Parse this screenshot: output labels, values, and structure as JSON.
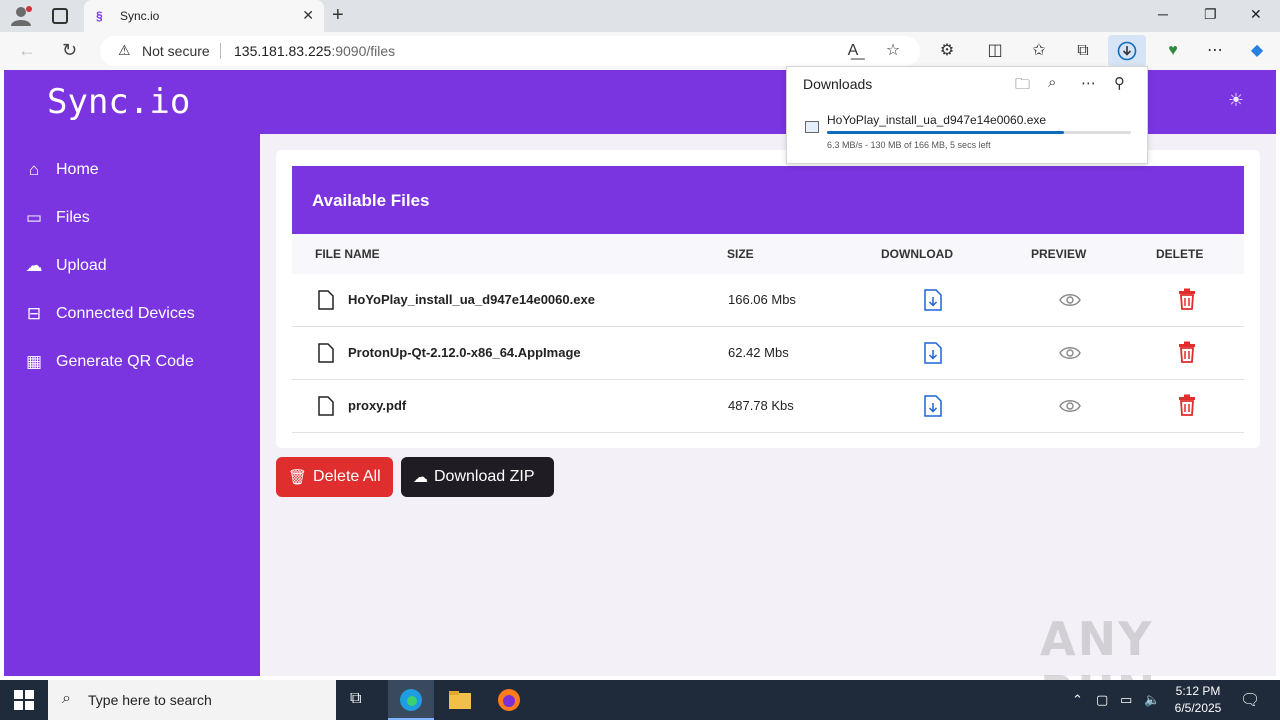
{
  "browser": {
    "tab_title": "Sync.io",
    "security_label": "Not secure",
    "url_host": "135.181.83.225",
    "url_rest": ":9090/files"
  },
  "app": {
    "brand": "Sync.io",
    "sidebar": {
      "items": [
        {
          "label": "Home",
          "icon": "home-icon"
        },
        {
          "label": "Files",
          "icon": "folder-icon"
        },
        {
          "label": "Upload",
          "icon": "cloud-upload-icon"
        },
        {
          "label": "Connected Devices",
          "icon": "router-icon"
        },
        {
          "label": "Generate QR Code",
          "icon": "qr-code-icon"
        }
      ]
    },
    "files_card": {
      "title": "Available Files",
      "columns": [
        "FILE NAME",
        "SIZE",
        "DOWNLOAD",
        "PREVIEW",
        "DELETE"
      ],
      "rows": [
        {
          "name": "HoYoPlay_install_ua_d947e14e0060.exe",
          "size": "166.06 Mbs"
        },
        {
          "name": "ProtonUp-Qt-2.12.0-x86_64.AppImage",
          "size": "62.42 Mbs"
        },
        {
          "name": "proxy.pdf",
          "size": "487.78 Kbs"
        }
      ]
    },
    "actions": {
      "delete_all": "Delete All",
      "download_zip": "Download ZIP"
    }
  },
  "downloads_panel": {
    "title": "Downloads",
    "file_name": "HoYoPlay_install_ua_d947e14e0060.exe",
    "status": "6.3 MB/s - 130 MB of 166 MB, 5 secs left",
    "progress": 0.78
  },
  "watermark": "ANY RUN",
  "taskbar": {
    "search_placeholder": "Type here to search",
    "time": "5:12 PM",
    "date": "6/5/2025"
  },
  "colors": {
    "accent": "#7a35e0",
    "danger": "#e02d2d",
    "dark_button": "#1f1c24",
    "link_blue": "#1c64d8"
  }
}
